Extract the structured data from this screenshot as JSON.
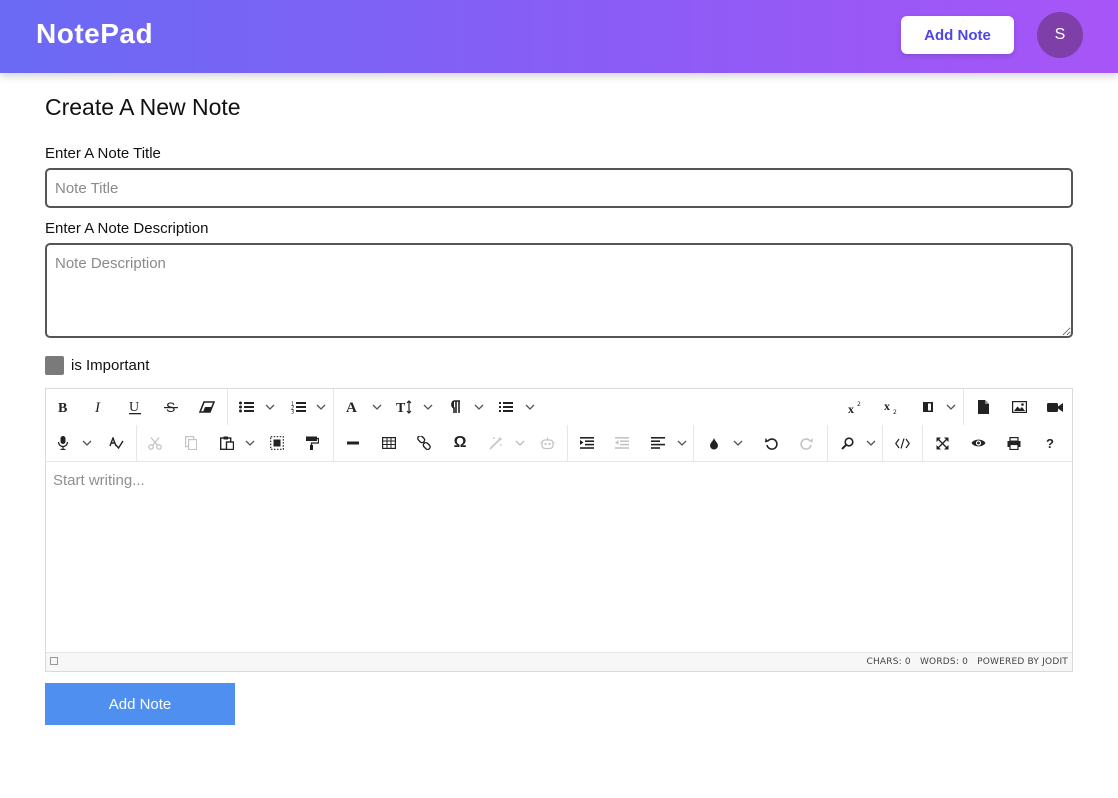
{
  "header": {
    "brand": "NotePad",
    "add_note_label": "Add Note",
    "avatar_initial": "S"
  },
  "form": {
    "heading": "Create A New Note",
    "title_label": "Enter A Note Title",
    "title_placeholder": "Note Title",
    "title_value": "",
    "description_label": "Enter A Note Description",
    "description_placeholder": "Note Description",
    "description_value": "",
    "important_label": "is Important",
    "important_checked": false
  },
  "editor": {
    "placeholder": "Start writing...",
    "status": {
      "chars": "CHARS: 0",
      "words": "WORDS: 0",
      "powered": "POWERED BY JODIT"
    },
    "toolbar_row1": [
      "bold-icon",
      "italic-icon",
      "underline-icon",
      "strikethrough-icon",
      "eraser-icon",
      "bullet-list-icon",
      "numbered-list-icon",
      "font-icon",
      "font-size-icon",
      "paragraph-icon",
      "line-height-icon",
      "superscript-icon",
      "subscript-icon",
      "classname-icon",
      "file-icon",
      "image-icon",
      "video-icon"
    ],
    "toolbar_row2": [
      "microphone-icon",
      "spellcheck-icon",
      "cut-icon",
      "copy-icon",
      "paste-icon",
      "select-all-icon",
      "format-painter-icon",
      "horizontal-rule-icon",
      "table-icon",
      "link-icon",
      "symbol-icon",
      "ai-assistant-icon",
      "ai-commands-icon",
      "indent-icon",
      "outdent-icon",
      "align-icon",
      "brush-color-icon",
      "undo-icon",
      "redo-icon",
      "find-icon",
      "source-icon",
      "fullsize-icon",
      "preview-icon",
      "print-icon",
      "help-icon"
    ],
    "symbol_glyph": "Ω",
    "help_glyph": "?"
  },
  "submit_label": "Add Note",
  "colors": {
    "header_start": "#6a6af4",
    "header_end": "#a855f7",
    "accent": "#4f46e5",
    "submit": "#4f8ff0",
    "avatar": "#7e3fa8"
  }
}
